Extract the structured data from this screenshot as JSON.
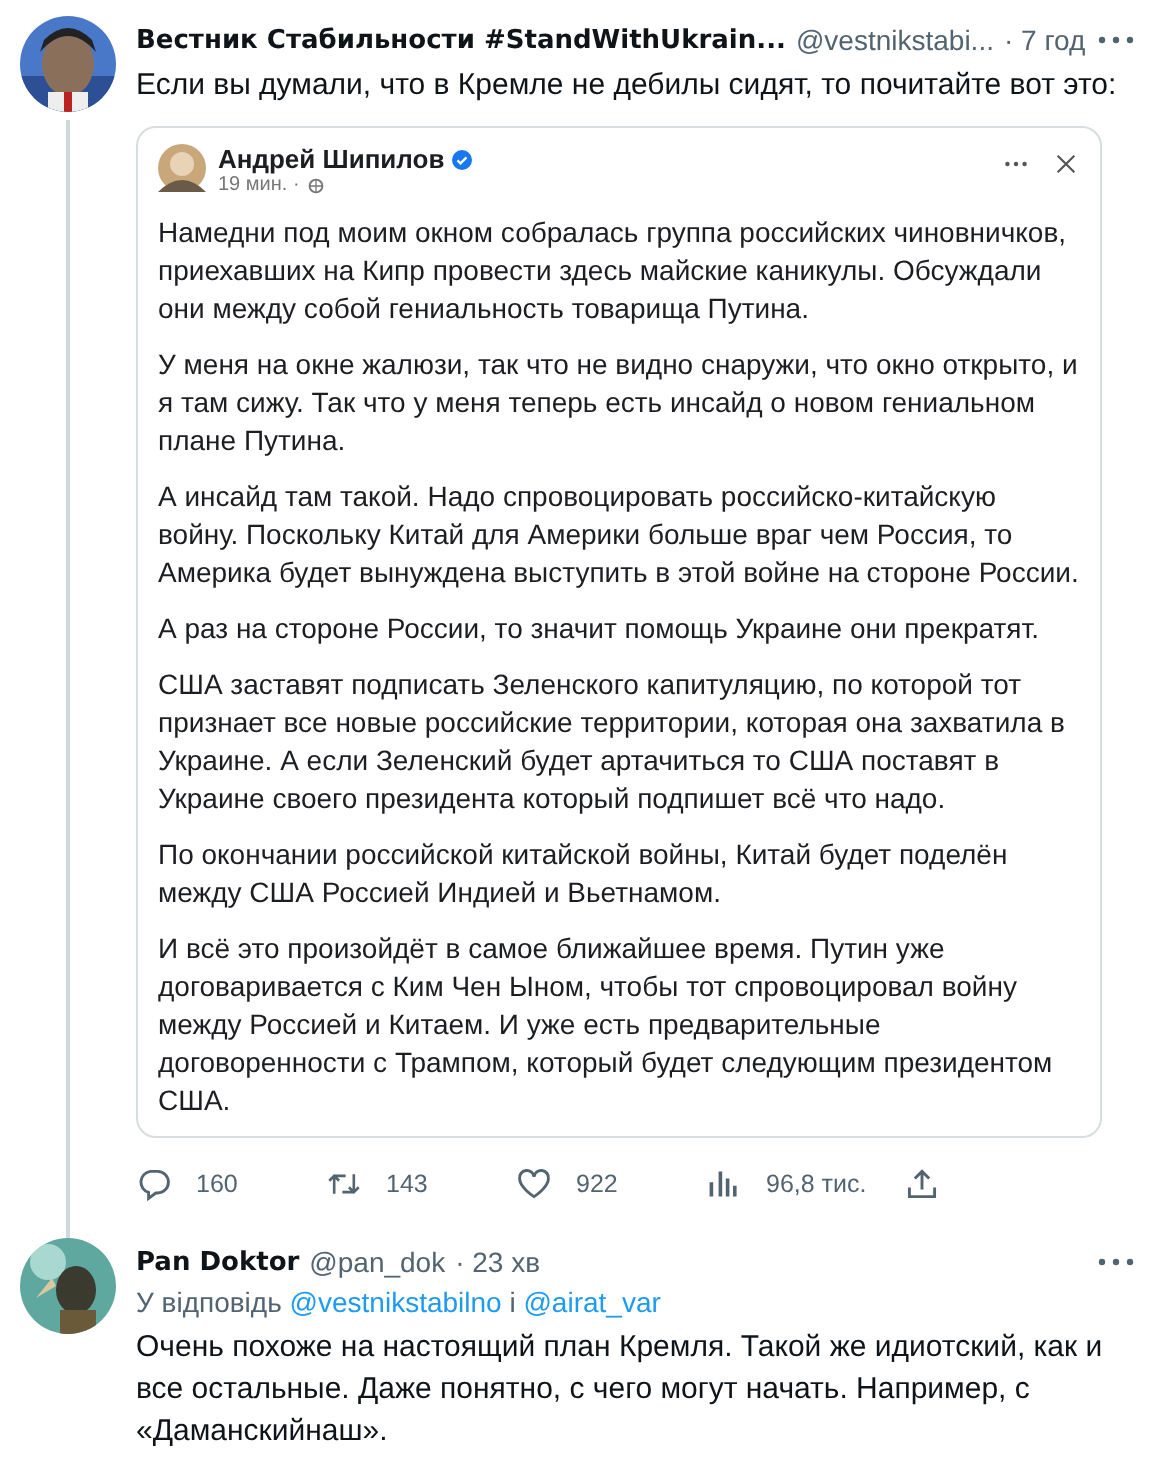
{
  "tweets": [
    {
      "display_name": "Вестник Стабильности #StandWithUkrain...",
      "handle": "@vestnikstabi...",
      "time": "· 7 год",
      "text": "Если вы думали, что в Кремле не дебилы сидят, то почитайте вот это:",
      "thread_line": true,
      "embedded_post": {
        "author": "Андрей Шипилов",
        "verified": true,
        "time": "19 мин. ·",
        "paragraphs": [
          "Намедни под моим окном собралась группа российских чиновничков, приехавших на Кипр провести здесь майские каникулы. Обсуждали они между собой гениальность товарища Путина.",
          "У меня на окне жалюзи, так что не видно снаружи, что окно открыто, и я там сижу. Так что у меня теперь есть инсайд о новом гениальном плане Путина.",
          "А инсайд там такой. Надо спровоцировать российско-китайскую войну. Поскольку Китай для Америки больше враг чем Россия, то Америка будет вынуждена выступить в этой войне на стороне России.",
          "А раз на стороне России, то значит помощь Украине они прекратят.",
          "США заставят подписать Зеленского капитуляцию, по которой тот признает все новые российские территории, которая она захватила в Украине. А если Зеленский будет артачиться то США поставят в Украине своего президента который подпишет всё что надо.",
          "По окончании российской китайской войны, Китай будет поделён между США Россией Индией и Вьетнамом.",
          "И всё это произойдёт в самое ближайшее время. Путин уже договаривается с Ким Чен Ыном, чтобы тот спровоцировал войну между Россией и Китаем. И уже есть предварительные договоренности с Трампом, который будет следующим президентом США."
        ]
      },
      "actions": [
        {
          "kind": "reply",
          "count": "160"
        },
        {
          "kind": "retweet",
          "count": "143"
        },
        {
          "kind": "like",
          "count": "922"
        },
        {
          "kind": "views",
          "count": "96,8 тис."
        },
        {
          "kind": "share"
        }
      ]
    },
    {
      "display_name": "Pan Doktor",
      "handle": "@pan_dok",
      "time": "· 23 хв",
      "reply_to": {
        "prefix": "У відповідь",
        "mentions": [
          "@vestnikstabilno",
          "@airat_var"
        ],
        "joiner": "і"
      },
      "text": "Очень похоже на настоящий план Кремля. Такой же идиотский, как и все остальные. Даже понятно, с чего могут начать. Например, с «Даманскийнаш».",
      "thread_line": false
    }
  ]
}
